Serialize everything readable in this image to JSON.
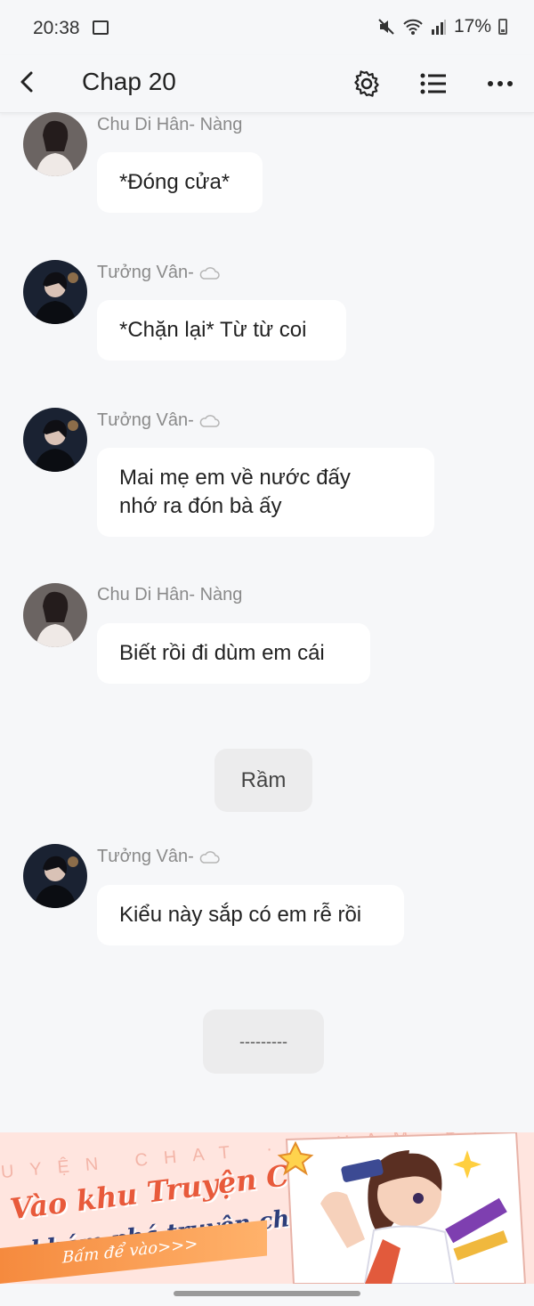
{
  "status_bar": {
    "time": "20:38",
    "battery": "17%",
    "icons": [
      "gallery-icon",
      "mute-icon",
      "wifi-icon",
      "signal-icon",
      "battery-icon"
    ]
  },
  "header": {
    "title": "Chap 20",
    "icons": [
      "back-arrow-icon",
      "gear-icon",
      "list-icon",
      "more-icon"
    ]
  },
  "messages": [
    {
      "name": "Chu Di Hân- Nàng",
      "text": "*Đóng cửa*"
    },
    {
      "name": "Tưởng Vân-",
      "text": "*Chặn lại* Từ từ coi"
    },
    {
      "name": "Tưởng Vân-",
      "text": "Mai mẹ em về nước đấy\nnhớ ra đón bà ấy"
    },
    {
      "name": "Chu Di Hân- Nàng",
      "text": "Biết rồi đi dùm em cái"
    },
    {
      "name": "Tưởng Vân-",
      "text": "Kiểu này sắp có em rễ rồi"
    }
  ],
  "system_messages": [
    "Rầm",
    "---------"
  ],
  "banner": {
    "bg_text": "UYỆN CHAT · KHÁM PHÁ",
    "line1": "Vào khu Truyện Chat,",
    "line2": "khám phá truyện chất",
    "cta": "Bấm để vào>>>"
  },
  "colors": {
    "background": "#f6f7f9",
    "bubble": "#ffffff",
    "name": "#8a8a8a",
    "system_bubble": "#ececed",
    "banner_accent": "#e85a3b"
  }
}
